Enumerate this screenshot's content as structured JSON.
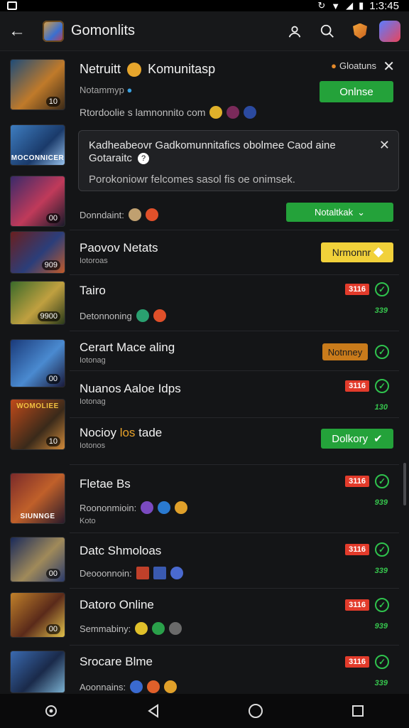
{
  "status_bar": {
    "time": "1:3:45"
  },
  "app_bar": {
    "title": "Gomonlits"
  },
  "top_item": {
    "title": "Netruitt",
    "title_suffix": "Komunitasp",
    "subtitle": "Notammyp",
    "meta": "Rtordoolie s lamnonnito com",
    "badge": "Gloatuns",
    "button": "Onlnse",
    "thumb_tag": "10"
  },
  "popup": {
    "title": "Kadheabeovr Gadkomunnitafics obolmee Caod aine Gotaraitc",
    "text": "Porokoniowr felcomes sasol fis oe onimsek."
  },
  "row_dominant": {
    "meta": "Donndaint:",
    "button": "Notaltkak",
    "banner": "MOCONNICER",
    "thumb_tag": "00"
  },
  "items": [
    {
      "title": "Paovov Netats",
      "sub": "Iotoroas",
      "tag_label": "Nrmonnr",
      "thumb_tag": "909"
    },
    {
      "title": "Tairo",
      "sub": "Detonnoning",
      "red": "3116",
      "num": "339",
      "thumb_tag": "9900"
    },
    {
      "title": "Cerart Mace aling",
      "sub": "Iotonag",
      "tag_label": "Notnney",
      "thumb_tag": "00"
    },
    {
      "title": "Nuanos Aaloe Idps",
      "sub": "Iotonag",
      "red": "3116",
      "num": "130"
    },
    {
      "title": "Nocioy",
      "title_hl": "los",
      "title_end": "tade",
      "sub": "Iotonos",
      "button": "Dolkory",
      "banner": "WOMOLIEE",
      "thumb_tag": "10"
    },
    {
      "title": "Fletae Bs",
      "sub": "Roononmioin:",
      "sub2": "Koto",
      "red": "3116",
      "num": "939",
      "banner": "SIUNNGE"
    },
    {
      "title": "Datc Shmoloas",
      "sub": "Deooonnoin:",
      "red": "3116",
      "num": "339",
      "thumb_tag": "00"
    },
    {
      "title": "Datoro Online",
      "sub": "Semmabiny:",
      "red": "3116",
      "num": "939",
      "thumb_tag": "00"
    },
    {
      "title": "Srocare Blme",
      "sub": "Aoonnains:",
      "red": "3116",
      "num": "339"
    }
  ]
}
